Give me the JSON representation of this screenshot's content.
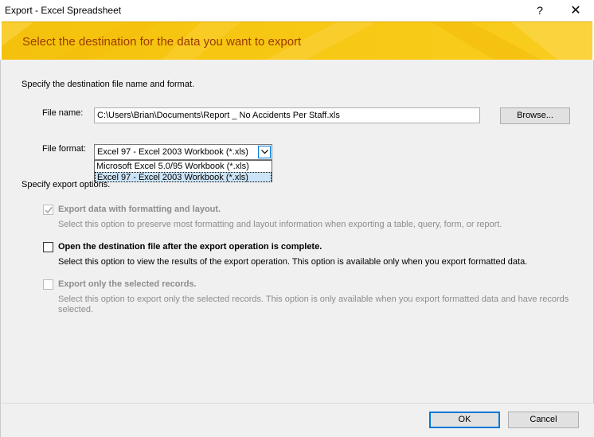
{
  "window": {
    "title": "Export - Excel Spreadsheet",
    "help_glyph": "?",
    "close_glyph": "✕"
  },
  "banner": {
    "heading": "Select the destination for the data you want to export"
  },
  "form": {
    "intro": "Specify the destination file name and format.",
    "file_name_label": "File name:",
    "file_name_value": "C:\\Users\\Brian\\Documents\\Report _ No Accidents Per Staff.xls",
    "browse_label": "Browse...",
    "file_format_label": "File format:",
    "file_format_value": "Excel 97 - Excel 2003 Workbook (*.xls)",
    "file_format_options": [
      "Microsoft Excel 5.0/95 Workbook (*.xls)",
      "Excel 97 - Excel 2003 Workbook (*.xls)"
    ],
    "export_options_label": "Specify export options."
  },
  "options": [
    {
      "title": "Export data with formatting and layout.",
      "description": "Select this option to preserve most formatting and layout information when exporting a table, query, form, or report.",
      "checked": true,
      "enabled": false
    },
    {
      "title": "Open the destination file after the export operation is complete.",
      "description": "Select this option to view the results of the export operation. This option is available only when you export formatted data.",
      "checked": false,
      "enabled": true
    },
    {
      "title": "Export only the selected records.",
      "description": "Select this option to export only the selected records. This option is only available when you export formatted data and have records selected.",
      "checked": false,
      "enabled": false
    }
  ],
  "buttons": {
    "ok": "OK",
    "cancel": "Cancel"
  },
  "colors": {
    "banner": "#f7c814",
    "banner_text": "#9c3b00",
    "focus": "#0078d7"
  }
}
